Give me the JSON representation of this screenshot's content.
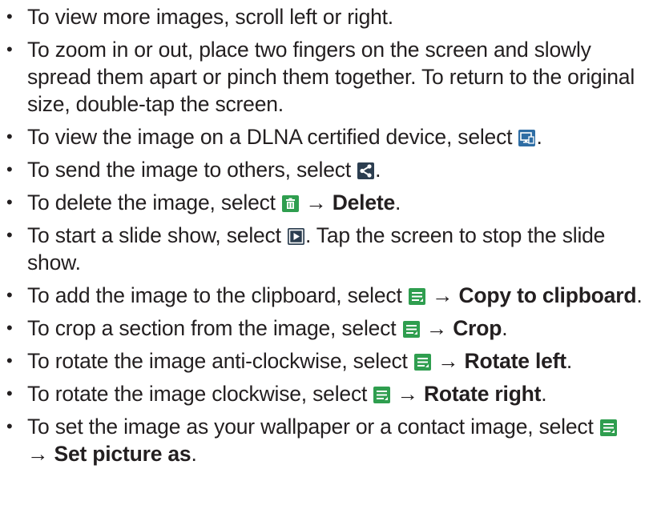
{
  "items": [
    {
      "text": "To view more images, scroll left or right."
    },
    {
      "text": "To zoom in or out, place two fingers on the screen and slowly spread them apart or pinch them together. To return to the original size, double-tap the screen."
    },
    {
      "pre": "To view the image on a DLNA certified device, select",
      "icon": "dlna-icon",
      "post": "."
    },
    {
      "pre": "To send the image to others, select",
      "icon": "share-icon",
      "post": "."
    },
    {
      "pre": "To delete the image, select",
      "icon": "delete-icon",
      "arrow": "→",
      "bold": "Delete",
      "post": "."
    },
    {
      "pre": "To start a slide show, select",
      "icon": "play-icon",
      "post": ". Tap the screen to stop the slide show."
    },
    {
      "pre": "To add the image to the clipboard, select",
      "icon": "menu-icon",
      "arrow": "→",
      "bold": "Copy to clipboard",
      "post": "."
    },
    {
      "pre": "To crop a section from the image, select",
      "icon": "menu-icon",
      "arrow": "→",
      "bold": "Crop",
      "post": "."
    },
    {
      "pre": "To rotate the image anti-clockwise, select",
      "icon": "menu-icon",
      "arrow": "→",
      "bold": "Rotate left",
      "post": "."
    },
    {
      "pre": "To rotate the image clockwise, select",
      "icon": "menu-icon",
      "arrow": "→",
      "bold": "Rotate right",
      "post": "."
    },
    {
      "pre": "To set the image as your wallpaper or a contact image, select",
      "icon": "menu-icon",
      "arrow": "→",
      "bold": "Set picture as",
      "post": "."
    }
  ],
  "bullet": "•",
  "colors": {
    "text": "#231f20",
    "dlna_icon": "#2e6da4",
    "green_icon": "#2f9e4f",
    "dark_icon": "#2c3e50"
  }
}
